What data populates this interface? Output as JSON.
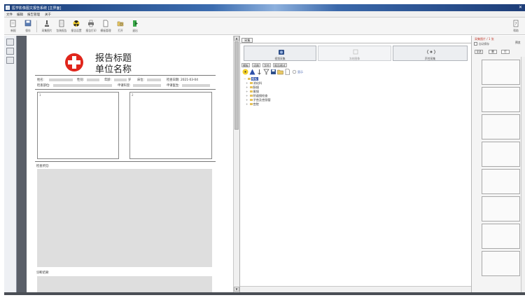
{
  "window": {
    "title": "医学影像图文报告系统 [主界面]",
    "close_glyph": "✕"
  },
  "menu": [
    "文件",
    "编辑",
    "报告管理",
    "关于"
  ],
  "toolbar": {
    "left_buttons": [
      {
        "icon": "new-report-icon",
        "label": "新报"
      },
      {
        "icon": "save-icon",
        "label": "保存"
      },
      {
        "icon": "microscope-icon",
        "label": "采集图片"
      },
      {
        "icon": "document-icon",
        "label": "包装报告"
      },
      {
        "icon": "radiation-icon",
        "label": "报告设置"
      },
      {
        "icon": "printer-icon",
        "label": "报告打印"
      },
      {
        "icon": "page-icon",
        "label": "模板管理"
      },
      {
        "icon": "folder-icon",
        "label": "打开"
      },
      {
        "icon": "exit-icon",
        "label": "退出"
      }
    ],
    "right_button": {
      "icon": "help-icon",
      "label": "帮助"
    }
  },
  "report": {
    "title": "报告标题",
    "unit": "单位名称",
    "fields_row1": [
      "姓名:",
      "性别:",
      "年龄:",
      "岁",
      "床位:",
      "检查日期: 2021-03-04"
    ],
    "fields_row2": [
      "检查部位:",
      "申请科室:",
      "申请医生:"
    ],
    "image_labels": [
      "1",
      "2"
    ],
    "findings_label": "检查所见:",
    "diagnosis_label": "诊断结果:"
  },
  "panel": {
    "top_tab": "采集",
    "big_buttons": [
      "视频采集",
      "冻结图像",
      "声控采集"
    ],
    "sub_tabs": [
      "模板",
      "词典",
      "字符",
      "报告格式"
    ],
    "toolbar_checkbox": "显示",
    "tree_items": [
      "模板",
      "消化科",
      "肠镜",
      "胃镜",
      "阴道镜检查",
      "子宫及宫颈管",
      "宫腔"
    ],
    "collapse_glyph": "−",
    "expand_glyph": "+"
  },
  "rightpanel": {
    "header": "采集图片 / 1 张",
    "checkbox_label": "自动保存",
    "side_label": "预览",
    "buttons": [
      "全选",
      "删",
      "打"
    ]
  },
  "colors": {
    "titlebar": "#1c3f7a",
    "cross": "#e0261c",
    "dark_strip": "#5a5f68"
  }
}
